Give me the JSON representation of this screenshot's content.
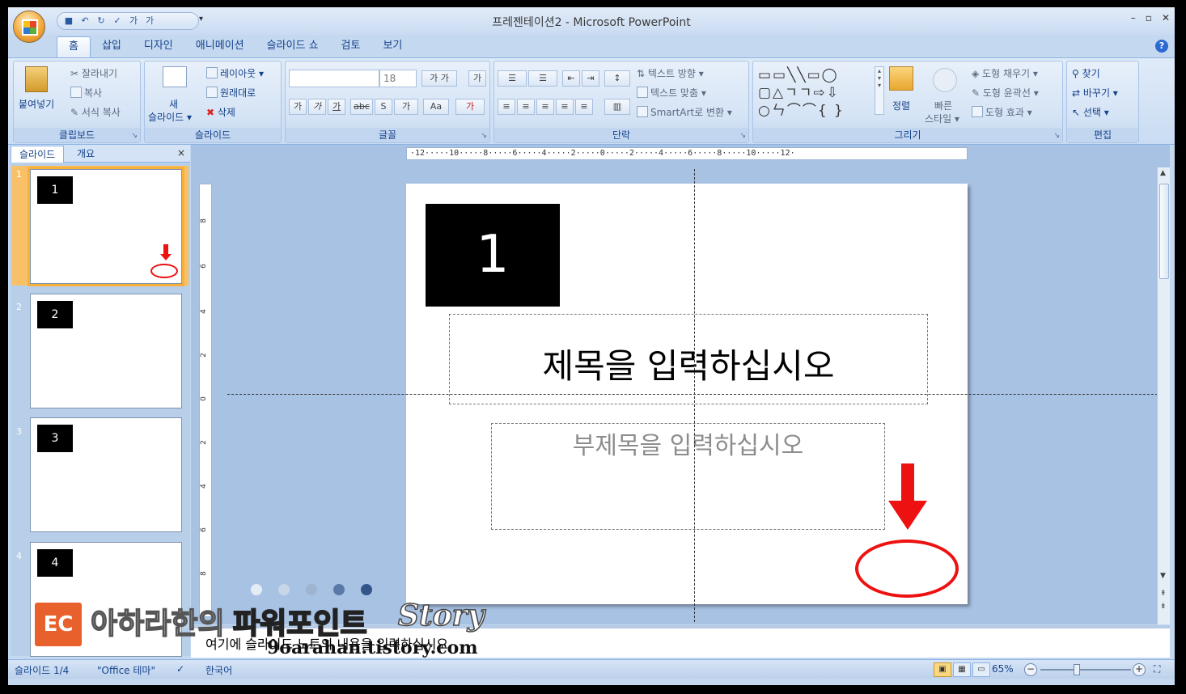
{
  "window": {
    "title": "프레젠테이션2 - Microsoft PowerPoint",
    "controls": [
      "–",
      "▫",
      "✕"
    ]
  },
  "qat": {
    "more": "▾"
  },
  "tabs": [
    "홈",
    "삽입",
    "디자인",
    "애니메이션",
    "슬라이드 쇼",
    "검토",
    "보기"
  ],
  "help": "?",
  "ribbon": {
    "clipboard": {
      "label": "클립보드",
      "paste": "붙여넣기",
      "cut": "잘라내기",
      "copy": "복사",
      "format_painter": "서식 복사"
    },
    "slides": {
      "label": "슬라이드",
      "new_slide_1": "새",
      "new_slide_2": "슬라이드 ▾",
      "layout": "레이아웃 ▾",
      "reset": "원래대로",
      "delete": "삭제"
    },
    "font": {
      "label": "글꼴",
      "font_name": "",
      "font_size": "18"
    },
    "paragraph": {
      "label": "단락",
      "text_direction": "텍스트 방향 ▾",
      "align_text": "텍스트 맞춤 ▾",
      "smartart": "SmartArt로 변환 ▾"
    },
    "drawing": {
      "label": "그리기",
      "arrange": "정렬",
      "quick_styles_1": "빠른",
      "quick_styles_2": "스타일 ▾",
      "fill": "도형 채우기 ▾",
      "outline": "도형 윤곽선 ▾",
      "effects": "도형 효과 ▾"
    },
    "editing": {
      "label": "편집",
      "find": "찾기",
      "replace": "바꾸기 ▾",
      "select": "선택 ▾"
    }
  },
  "pane": {
    "tabs": [
      "슬라이드",
      "개요"
    ],
    "close": "×",
    "slides": [
      {
        "num": "1",
        "label": "1"
      },
      {
        "num": "2",
        "label": "2"
      },
      {
        "num": "3",
        "label": "3"
      },
      {
        "num": "4",
        "label": "4"
      }
    ]
  },
  "ruler": {
    "horizontal": "·12·····10·····8·····6·····4·····2·····0·····2·····4·····6·····8·····10·····12·",
    "vertical": [
      "8",
      "6",
      "4",
      "2",
      "0",
      "2",
      "4",
      "6",
      "8"
    ]
  },
  "slide": {
    "number": "1",
    "title_placeholder": "제목을 입력하십시오",
    "subtitle_placeholder": "부제목을 입력하십시오"
  },
  "notes": {
    "placeholder": "여기에 슬라이드 노트의 내용을 입력하십시오"
  },
  "status": {
    "slide": "슬라이드 1/4",
    "theme": "\"Office 테마\"",
    "language": "한국어",
    "zoom": "65%",
    "zoom_level": 0.4
  },
  "watermark": {
    "logo": "EC",
    "text1": "아하라한의",
    "text2": "파워포인트",
    "text3": "Story",
    "url": "9oarahan.tistory.com",
    "dot_colors": [
      "#e6ecf5",
      "#c9d6e8",
      "#9fb4d1",
      "#5a79a8",
      "#34558a"
    ]
  },
  "colors": {
    "accent_red": "#ee1111",
    "selection": "#f9b03a"
  }
}
